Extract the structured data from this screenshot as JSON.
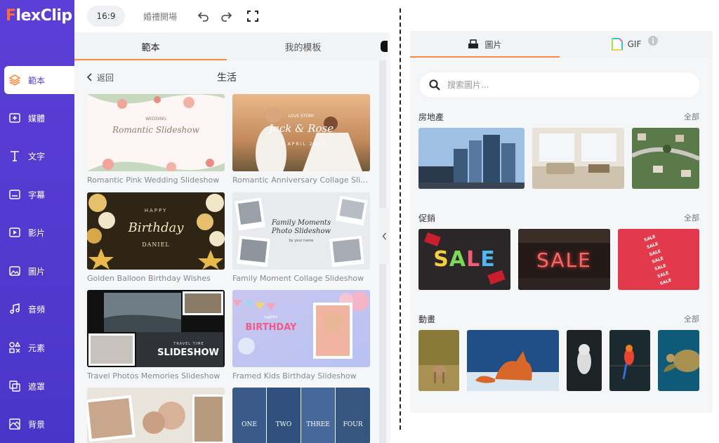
{
  "app": {
    "logo_f": "F",
    "logo_rest": "lexClip"
  },
  "sidebar": {
    "items": [
      {
        "label": "範本",
        "icon": "layers-icon"
      },
      {
        "label": "媒體",
        "icon": "media-add-icon"
      },
      {
        "label": "文字",
        "icon": "text-icon"
      },
      {
        "label": "字幕",
        "icon": "subtitle-icon"
      },
      {
        "label": "影片",
        "icon": "video-icon"
      },
      {
        "label": "圖片",
        "icon": "image-icon"
      },
      {
        "label": "音頻",
        "icon": "music-icon"
      },
      {
        "label": "元素",
        "icon": "elements-icon"
      },
      {
        "label": "遮罩",
        "icon": "mask-icon"
      },
      {
        "label": "背景",
        "icon": "background-icon"
      }
    ]
  },
  "topbar": {
    "ratio": "16:9",
    "title": "婚禮開場"
  },
  "templates": {
    "tabs": [
      "範本",
      "我的模板"
    ],
    "back": "返回",
    "category": "生活",
    "cards": [
      {
        "caption": "Romantic Pink Wedding Slideshow",
        "overlay": "Romantic Slideshow",
        "sub": "WEDDING"
      },
      {
        "caption": "Romantic Anniversary Collage Slide...",
        "overlay": "Jack & Rose",
        "sub": "LOVE STORY",
        "date": "14 APRIL 2022"
      },
      {
        "caption": "Golden Balloon Birthday Wishes",
        "overlay": "Birthday",
        "sub": "HAPPY",
        "name": "DANIEL"
      },
      {
        "caption": "Family Moment Collage Slideshow",
        "overlay": "Family Moments Photo Slideshow",
        "sub": "by your name"
      },
      {
        "caption": "Travel Photos Memories Slideshow",
        "overlay": "SLIDESHOW",
        "sub": "TRAVEL TIME"
      },
      {
        "caption": "Framed Kids Birthday Slideshow",
        "overlay": "BIRTHDAY",
        "sub": "HAPPY"
      },
      {
        "caption": ""
      },
      {
        "caption": "",
        "panels": [
          "ONE",
          "TWO",
          "THREE",
          "FOUR"
        ]
      }
    ]
  },
  "images": {
    "tabs": [
      {
        "label": "圖片",
        "icon": "image-tab-icon"
      },
      {
        "label": "GIF",
        "icon": "gif-icon"
      }
    ],
    "search_placeholder": "搜索圖片...",
    "sections": [
      {
        "title": "房地產",
        "all": "全部"
      },
      {
        "title": "促銷",
        "all": "全部",
        "sale_text": "SALE",
        "tag_text": "SALE"
      },
      {
        "title": "動畫",
        "all": "全部"
      }
    ]
  },
  "colors": {
    "sidebar": "#5b3fd6",
    "accent": "#ff8a3d",
    "logo_f": "#ff6a3d"
  }
}
